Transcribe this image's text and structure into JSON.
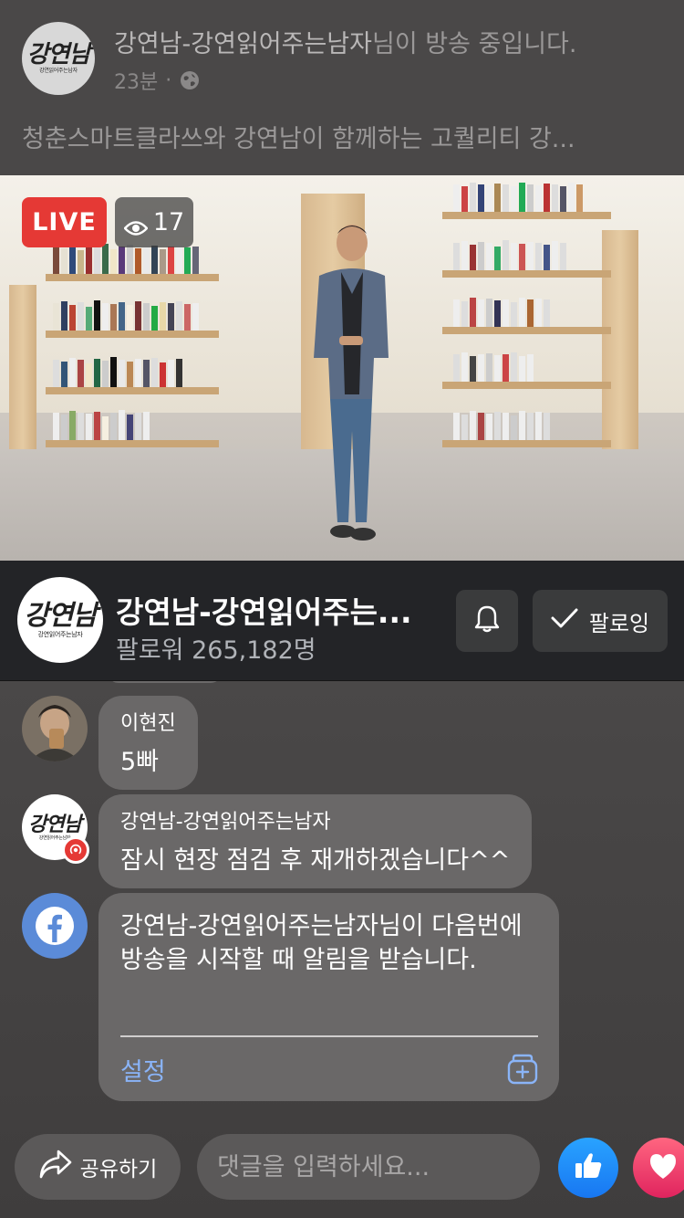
{
  "header": {
    "page_name": "강연남-강연읽어주는남자",
    "broadcast_suffix": "님이 방송 중입니다.",
    "time_ago": "23분",
    "separator": "·",
    "description": "청춘스마트클라쓰와 강연남이 함께하는 고퀄리티 강...",
    "logo_text": "강연남",
    "logo_subtext": "강연읽어주는남자"
  },
  "video": {
    "live_label": "LIVE",
    "viewer_count": "17"
  },
  "page_bar": {
    "name": "강연남-강연읽어주는...",
    "followers": "팔로워 265,182명",
    "follow_label": "팔로잉"
  },
  "comments": [
    {
      "author": "이현진",
      "text": "5빠"
    },
    {
      "author": "강연남-강연읽어주는남자",
      "text": "잠시 현장 점검 후 재개하겠습니다^^"
    }
  ],
  "notice": {
    "text": "강연남-강연읽어주는남자님이 다음번에 방송을 시작할 때 알림을 받습니다.",
    "settings_label": "설정"
  },
  "bottom": {
    "share_label": "공유하기",
    "comment_placeholder": "댓글을 입력하세요..."
  },
  "colors": {
    "live": "#e53935",
    "facebook_blue": "#1877f2",
    "link": "#8ab4f8",
    "love": "#e0245e"
  },
  "icons": {
    "globe": "globe-icon",
    "eye": "eye-icon",
    "bell": "bell-icon",
    "check": "check-icon",
    "share": "share-icon",
    "like": "thumbs-up-icon",
    "love": "heart-icon",
    "facebook": "facebook-logo-icon",
    "add_box": "add-box-icon"
  }
}
